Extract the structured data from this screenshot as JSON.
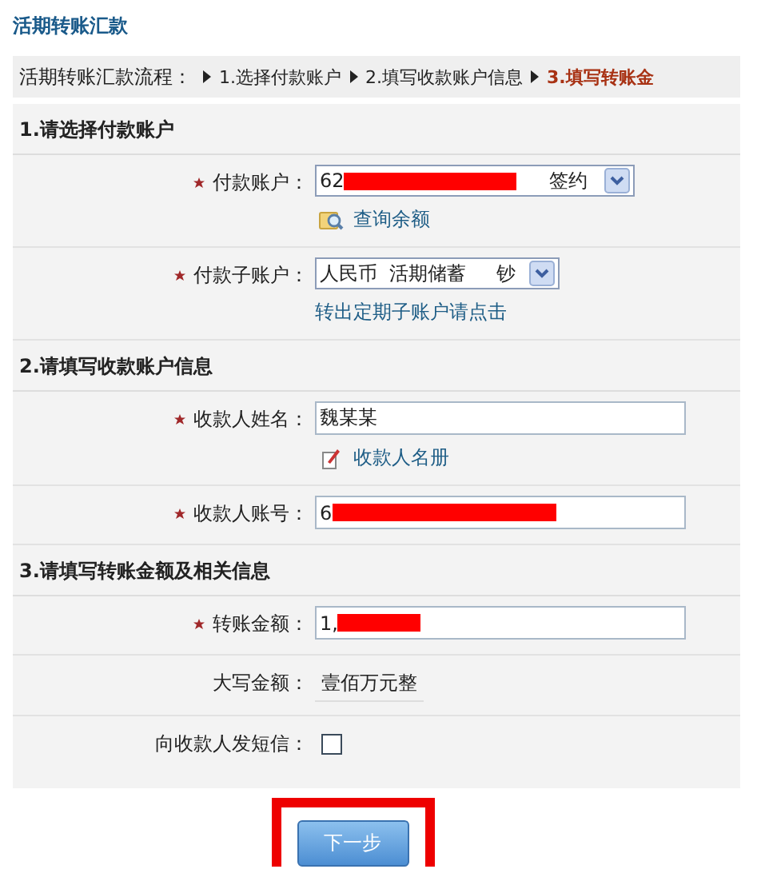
{
  "title": "活期转账汇款",
  "steps": {
    "label": "活期转账汇款流程：",
    "items": [
      {
        "text": "1.选择付款账户",
        "selected": false
      },
      {
        "text": "2.填写收款账户信息",
        "selected": false
      },
      {
        "text": "3.填写转账金",
        "selected": true
      }
    ]
  },
  "sections": [
    {
      "heading": "1.请选择付款账户",
      "rows": [
        {
          "kind": "select",
          "required": true,
          "label": "付款账户：",
          "value": "62",
          "redacted": true,
          "suffix": "签约",
          "link": "查询余额"
        },
        {
          "kind": "select",
          "required": true,
          "label": "付款子账户：",
          "value": "人民币  活期储蓄     钞",
          "redacted": false,
          "link": "转出定期子账户请点击"
        }
      ]
    },
    {
      "heading": "2.请填写收款账户信息",
      "rows": [
        {
          "kind": "input",
          "required": true,
          "label": "收款人姓名：",
          "value": "魏某某",
          "redacted": false,
          "link": "收款人名册"
        },
        {
          "kind": "input",
          "required": true,
          "label": "收款人账号：",
          "value": "6",
          "redacted": true
        }
      ]
    },
    {
      "heading": "3.请填写转账金额及相关信息",
      "rows": [
        {
          "kind": "input",
          "required": true,
          "label": "转账金额：",
          "value": "1,",
          "redacted": true
        },
        {
          "kind": "static",
          "required": false,
          "label": "大写金额：",
          "value": "壹佰万元整"
        },
        {
          "kind": "checkbox",
          "required": false,
          "label": "向收款人发短信：",
          "checked": false
        }
      ]
    }
  ],
  "submit": {
    "label": "下一步",
    "highlighted": true
  }
}
